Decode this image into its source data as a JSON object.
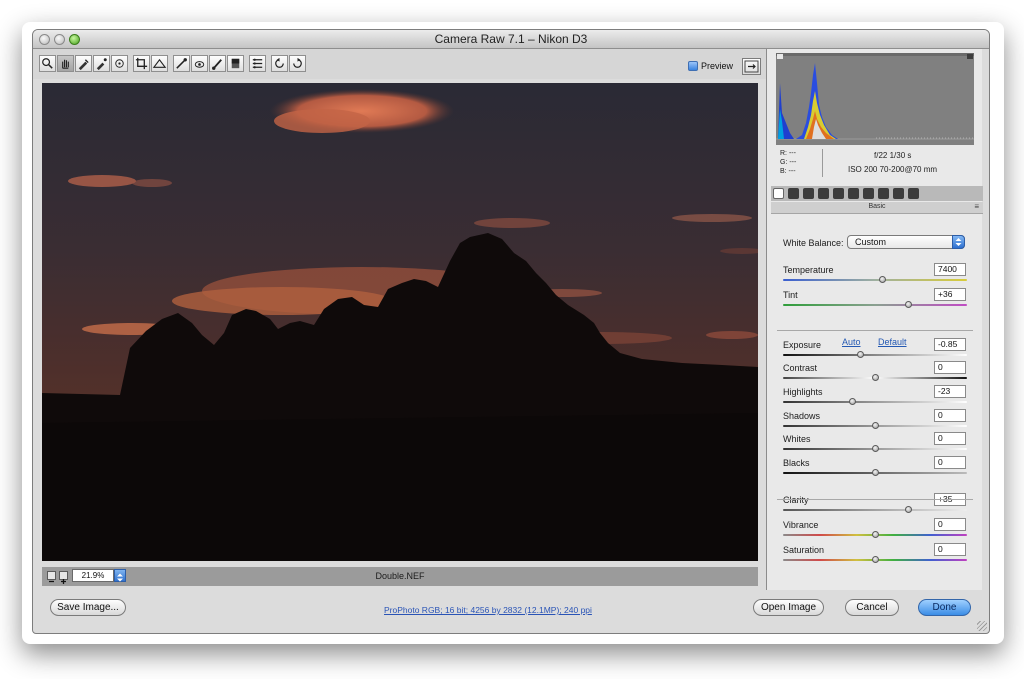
{
  "window": {
    "title": "Camera Raw 7.1  –  Nikon D3"
  },
  "toolbar": {
    "tools": [
      "zoom-icon",
      "hand-icon",
      "white-balance-icon",
      "color-sampler-icon",
      "target-adjust-icon",
      "crop-icon",
      "straighten-icon",
      "spot-removal-icon",
      "red-eye-icon",
      "adjustment-brush-icon",
      "graduated-filter-icon",
      "preferences-icon",
      "rotate-ccw-icon",
      "rotate-cw-icon"
    ],
    "preview_label": "Preview",
    "preview_checked": true
  },
  "image": {
    "filename": "Double.NEF",
    "zoom": "21.9%"
  },
  "info": {
    "r": "R:  ---",
    "g": "G:  ---",
    "b": "B:  ---",
    "aperture_shutter": "f/22   1/30 s",
    "iso_lens": "ISO 200   70-200@70 mm"
  },
  "panel": {
    "section_title": "Basic",
    "white_balance_label": "White Balance:",
    "white_balance_value": "Custom",
    "auto_label": "Auto",
    "default_label": "Default",
    "sliders": [
      {
        "label": "Temperature",
        "value": "7400",
        "pos": 0.54
      },
      {
        "label": "Tint",
        "value": "+36",
        "pos": 0.68
      },
      {
        "label": "Exposure",
        "value": "-0.85",
        "pos": 0.42
      },
      {
        "label": "Contrast",
        "value": "0",
        "pos": 0.5
      },
      {
        "label": "Highlights",
        "value": "-23",
        "pos": 0.38
      },
      {
        "label": "Shadows",
        "value": "0",
        "pos": 0.5
      },
      {
        "label": "Whites",
        "value": "0",
        "pos": 0.5
      },
      {
        "label": "Blacks",
        "value": "0",
        "pos": 0.5
      },
      {
        "label": "Clarity",
        "value": "+35",
        "pos": 0.68
      },
      {
        "label": "Vibrance",
        "value": "0",
        "pos": 0.5
      },
      {
        "label": "Saturation",
        "value": "0",
        "pos": 0.5
      }
    ]
  },
  "footer": {
    "save_label": "Save Image...",
    "workflow_info": "ProPhoto RGB; 16 bit; 4256 by 2832 (12.1MP); 240 ppi",
    "open_label": "Open Image",
    "cancel_label": "Cancel",
    "done_label": "Done"
  },
  "colors": {
    "accent_blue": "#3b8de6",
    "sky_top": "#2b2a36",
    "sky_glow": "#5a3228",
    "cloud_orange": "#d2714f"
  }
}
